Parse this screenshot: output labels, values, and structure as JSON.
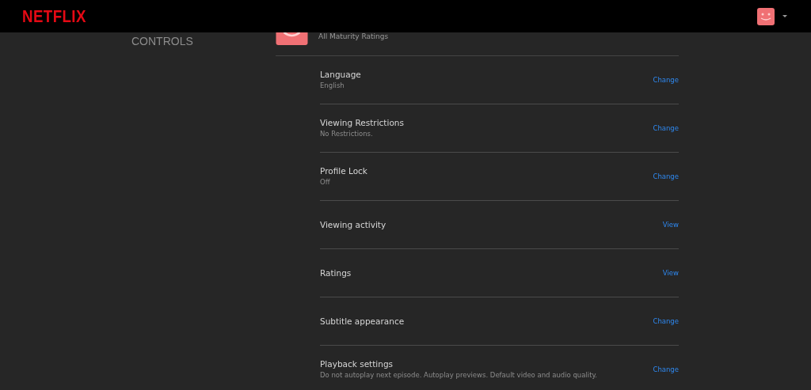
{
  "header": {
    "logo": "NETFLIX"
  },
  "sidebar": {
    "heading": "CONTROLS"
  },
  "profile": {
    "rating": "All Maturity Ratings"
  },
  "settings": [
    {
      "title": "Language",
      "value": "English",
      "action": "Change"
    },
    {
      "title": "Viewing Restrictions",
      "value": "No Restrictions.",
      "action": "Change"
    },
    {
      "title": "Profile Lock",
      "value": "Off",
      "action": "Change"
    },
    {
      "title": "Viewing activity",
      "action": "View"
    },
    {
      "title": "Ratings",
      "action": "View"
    },
    {
      "title": "Subtitle appearance",
      "action": "Change"
    },
    {
      "title": "Playback settings",
      "value": "Do not autoplay next episode. Autoplay previews. Default video and audio quality.",
      "action": "Change"
    }
  ]
}
